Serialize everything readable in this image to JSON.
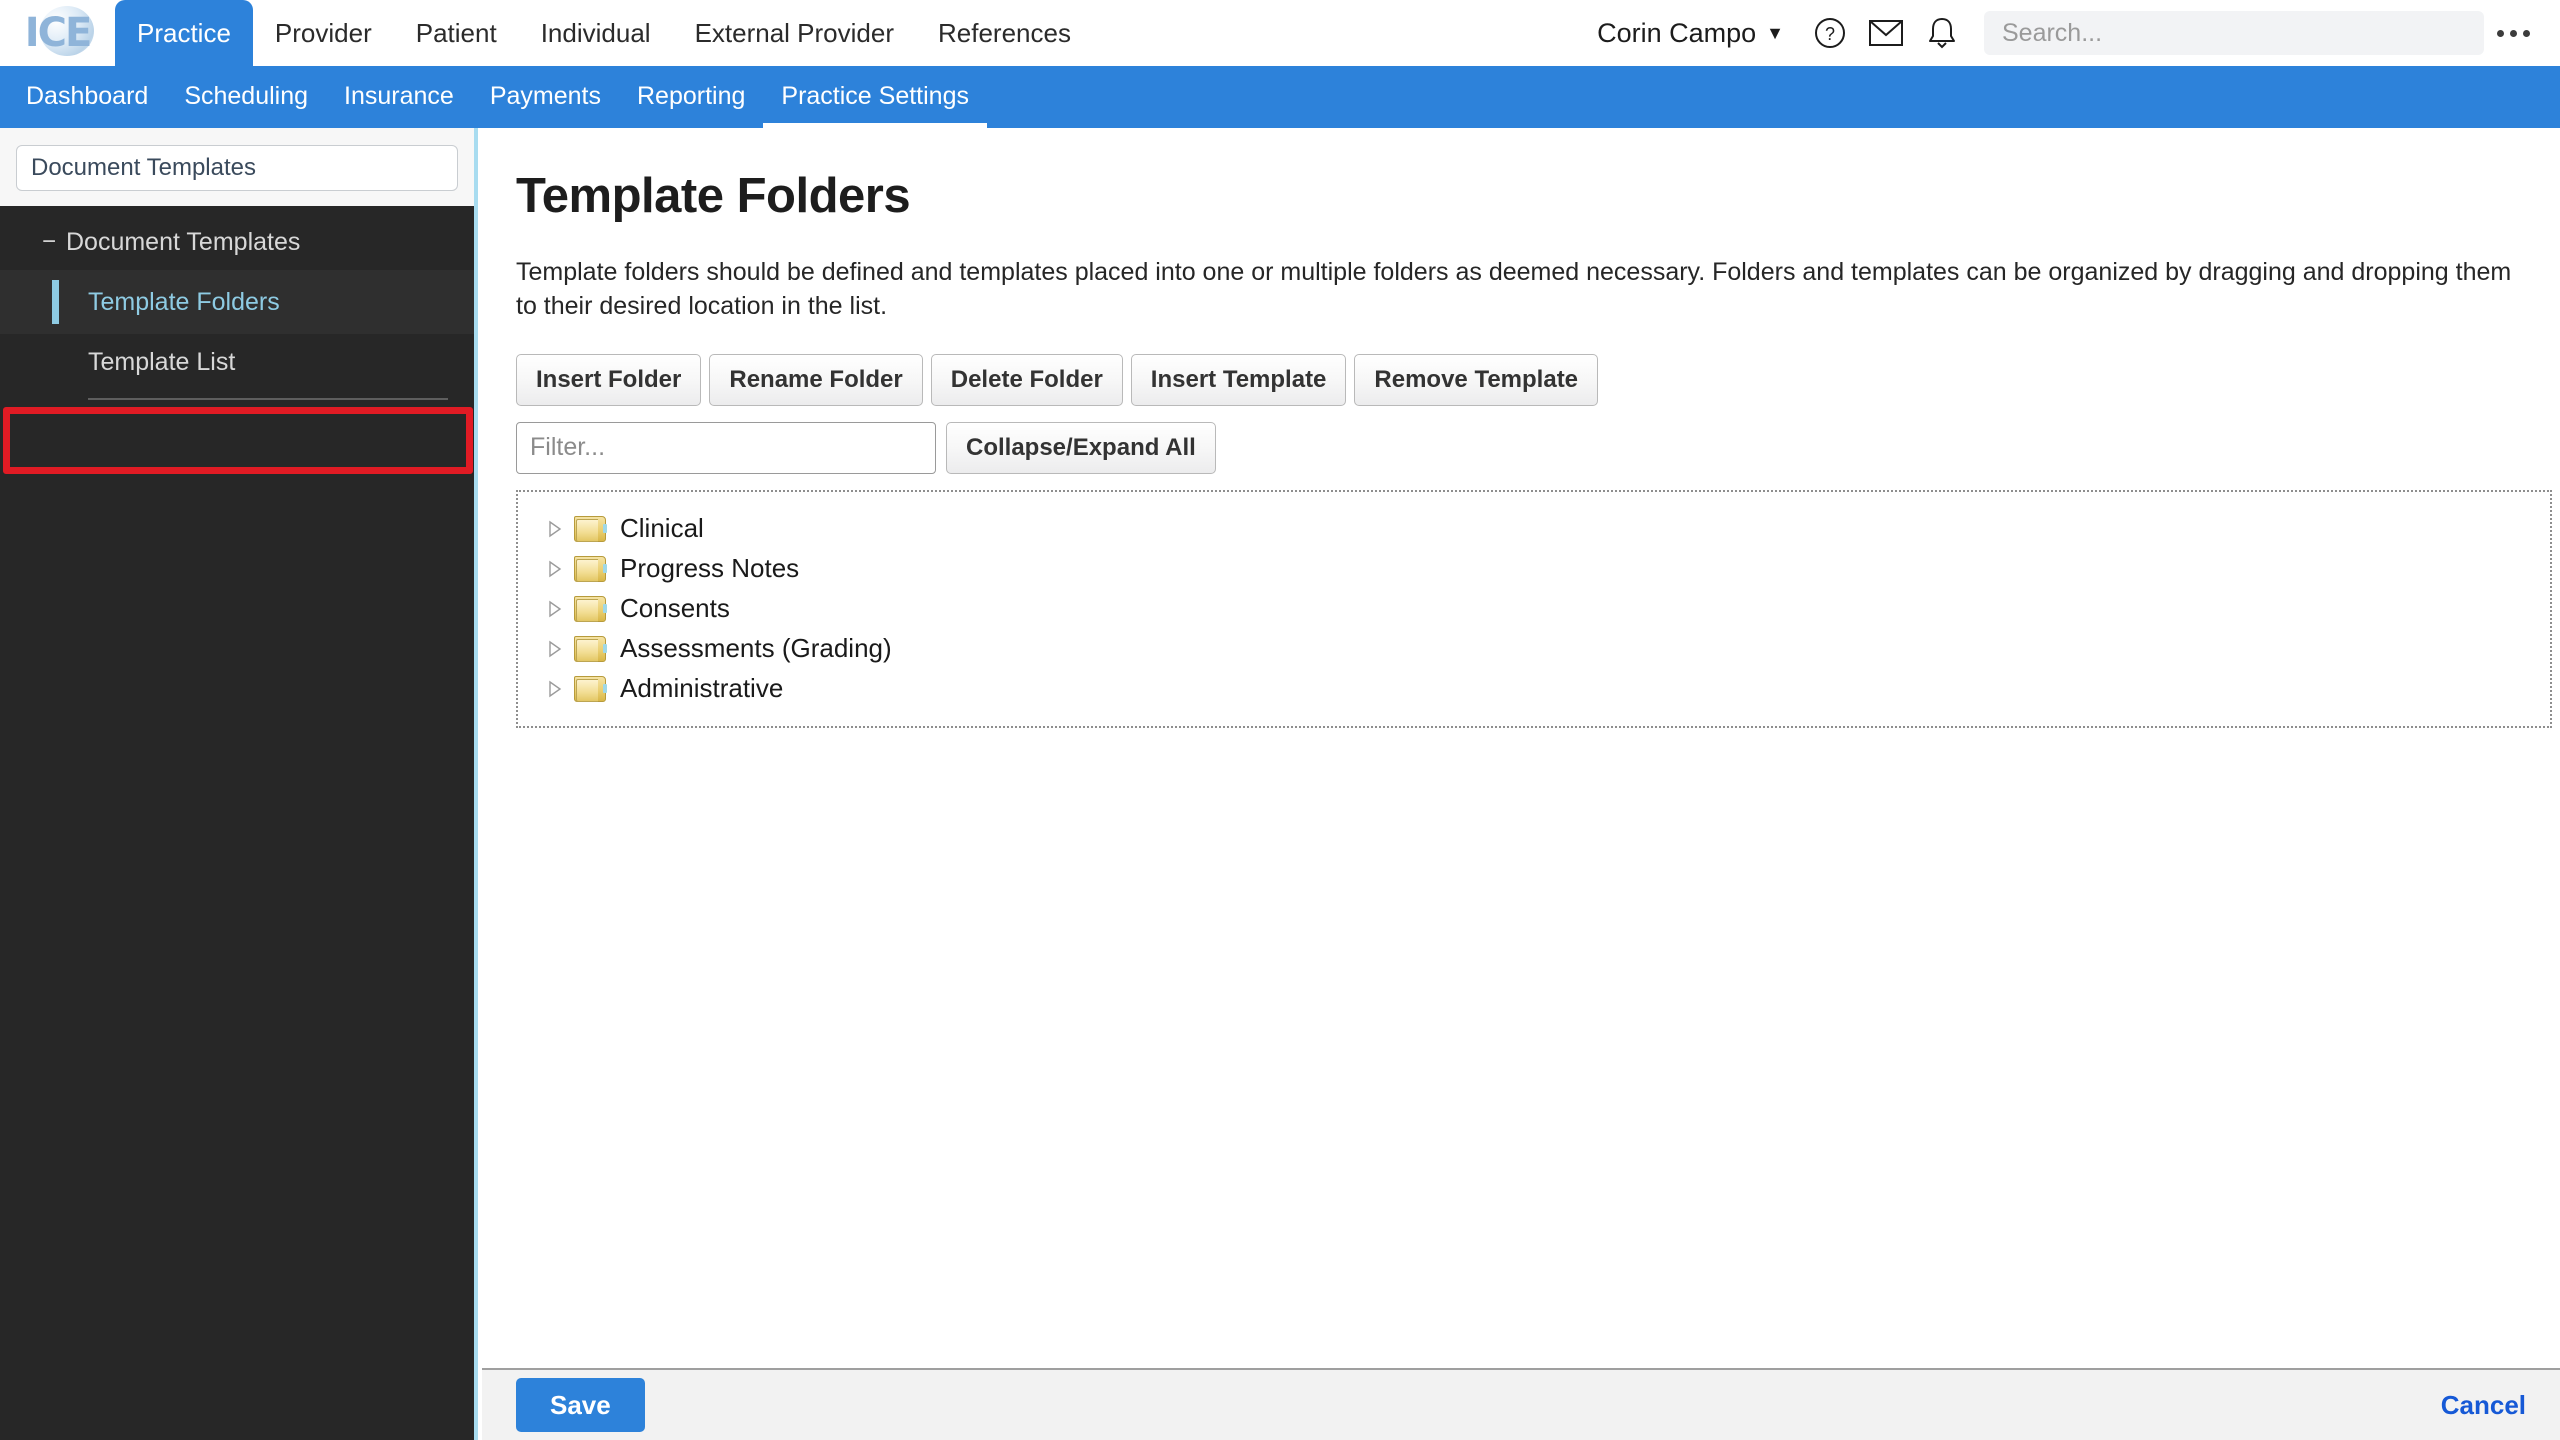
{
  "brand": {
    "logo_text": "ICE",
    "accent_blue": "#2d82da",
    "sidebar_bg": "#272727",
    "highlight_blue": "#8ecbe3",
    "annotation_red": "#e01b24",
    "link_blue": "#1659d6"
  },
  "top_bar": {
    "primary_nav": [
      {
        "label": "Practice",
        "active": true
      },
      {
        "label": "Provider",
        "active": false
      },
      {
        "label": "Patient",
        "active": false
      },
      {
        "label": "Individual",
        "active": false
      },
      {
        "label": "External Provider",
        "active": false
      },
      {
        "label": "References",
        "active": false
      }
    ],
    "user_name": "Corin Campo",
    "caret": "▼",
    "icons": [
      "help-icon",
      "mail-icon",
      "bell-icon"
    ],
    "search": {
      "value": "",
      "placeholder": "Search..."
    },
    "overflow_label": "..."
  },
  "secondary_nav": [
    {
      "label": "Dashboard",
      "active": false
    },
    {
      "label": "Scheduling",
      "active": false
    },
    {
      "label": "Insurance",
      "active": false
    },
    {
      "label": "Payments",
      "active": false
    },
    {
      "label": "Reporting",
      "active": false
    },
    {
      "label": "Practice Settings",
      "active": true
    }
  ],
  "sidebar": {
    "search": {
      "value": "Document Templates",
      "placeholder": ""
    },
    "tree": [
      {
        "label": "Document Templates",
        "toggle": "−",
        "level": 0,
        "selected": false
      },
      {
        "label": "Template Folders",
        "toggle": "",
        "level": 1,
        "selected": true
      },
      {
        "label": "Template List",
        "toggle": "",
        "level": 1,
        "selected": false
      }
    ]
  },
  "main": {
    "title": "Template Folders",
    "description": "Template folders should be defined and templates placed into one or multiple folders as deemed necessary. Folders and templates can be organized by dragging and dropping them to their desired location in the list.",
    "toolbar_buttons": [
      "Insert Folder",
      "Rename Folder",
      "Delete Folder",
      "Insert Template",
      "Remove Template"
    ],
    "filter": {
      "value": "",
      "placeholder": "Filter..."
    },
    "collapse_expand_label": "Collapse/Expand All",
    "folders": [
      {
        "name": "Clinical",
        "expanded": false
      },
      {
        "name": "Progress Notes",
        "expanded": false
      },
      {
        "name": "Consents",
        "expanded": false
      },
      {
        "name": "Assessments (Grading)",
        "expanded": false
      },
      {
        "name": "Administrative",
        "expanded": false
      }
    ]
  },
  "footer": {
    "save_label": "Save",
    "cancel_label": "Cancel"
  }
}
